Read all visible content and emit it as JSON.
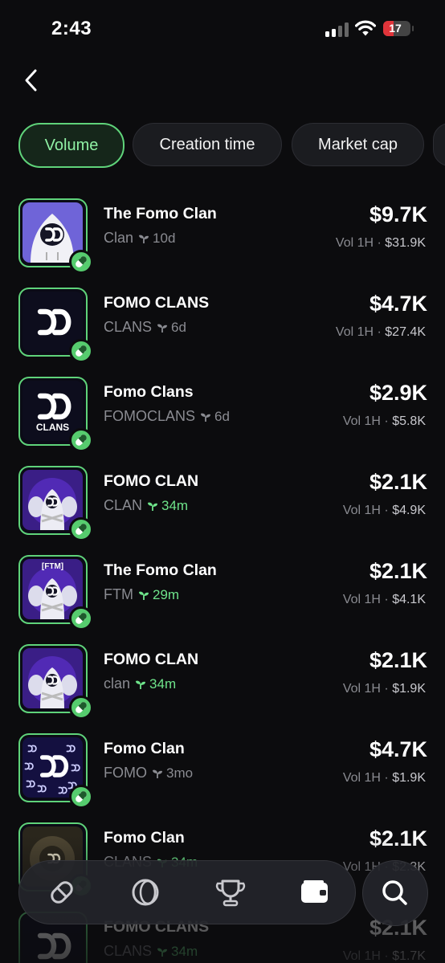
{
  "status_bar": {
    "time": "2:43",
    "battery": "17"
  },
  "filters": [
    {
      "label": "Volume",
      "active": true
    },
    {
      "label": "Creation time",
      "active": false
    },
    {
      "label": "Market cap",
      "active": false
    }
  ],
  "clans": [
    {
      "name": "The Fomo Clan",
      "ticker": "Clan",
      "age": "10d",
      "new": false,
      "market_cap": "$9.7K",
      "vol_label": "Vol 1H",
      "vol": "$31.9K"
    },
    {
      "name": "FOMO CLANS",
      "ticker": "CLANS",
      "age": "6d",
      "new": false,
      "market_cap": "$4.7K",
      "vol_label": "Vol 1H",
      "vol": "$27.4K"
    },
    {
      "name": "Fomo Clans",
      "ticker": "FOMOCLANS",
      "age": "6d",
      "new": false,
      "market_cap": "$2.9K",
      "vol_label": "Vol 1H",
      "vol": "$5.8K",
      "art_text": "CLANS"
    },
    {
      "name": "FOMO CLAN",
      "ticker": "CLAN",
      "age": "34m",
      "new": true,
      "market_cap": "$2.1K",
      "vol_label": "Vol 1H",
      "vol": "$4.9K"
    },
    {
      "name": "The Fomo Clan",
      "ticker": "FTM",
      "age": "29m",
      "new": true,
      "market_cap": "$2.1K",
      "vol_label": "Vol 1H",
      "vol": "$4.1K",
      "art_text": "[FTM]"
    },
    {
      "name": "FOMO CLAN",
      "ticker": "clan",
      "age": "34m",
      "new": true,
      "market_cap": "$2.1K",
      "vol_label": "Vol 1H",
      "vol": "$1.9K"
    },
    {
      "name": "Fomo Clan",
      "ticker": "FOMO",
      "age": "3mo",
      "new": false,
      "market_cap": "$4.7K",
      "vol_label": "Vol 1H",
      "vol": "$1.9K"
    },
    {
      "name": "Fomo Clan",
      "ticker": "CLANS",
      "age": "34m",
      "new": true,
      "market_cap": "$2.1K",
      "vol_label": "Vol 1H",
      "vol": "$2.3K"
    },
    {
      "name": "FOMO CLANS",
      "ticker": "CLANS",
      "age": "34m",
      "new": true,
      "market_cap": "$2.1K",
      "vol_label": "Vol 1H",
      "vol": "$1.7K"
    }
  ],
  "nav": {
    "items": [
      "pill-icon",
      "coin-icon",
      "trophy-icon",
      "wallet-icon"
    ],
    "search": "search-icon"
  },
  "colors": {
    "accent": "#5fd37a",
    "background": "#0c0c0e",
    "muted": "#8a8b91"
  }
}
